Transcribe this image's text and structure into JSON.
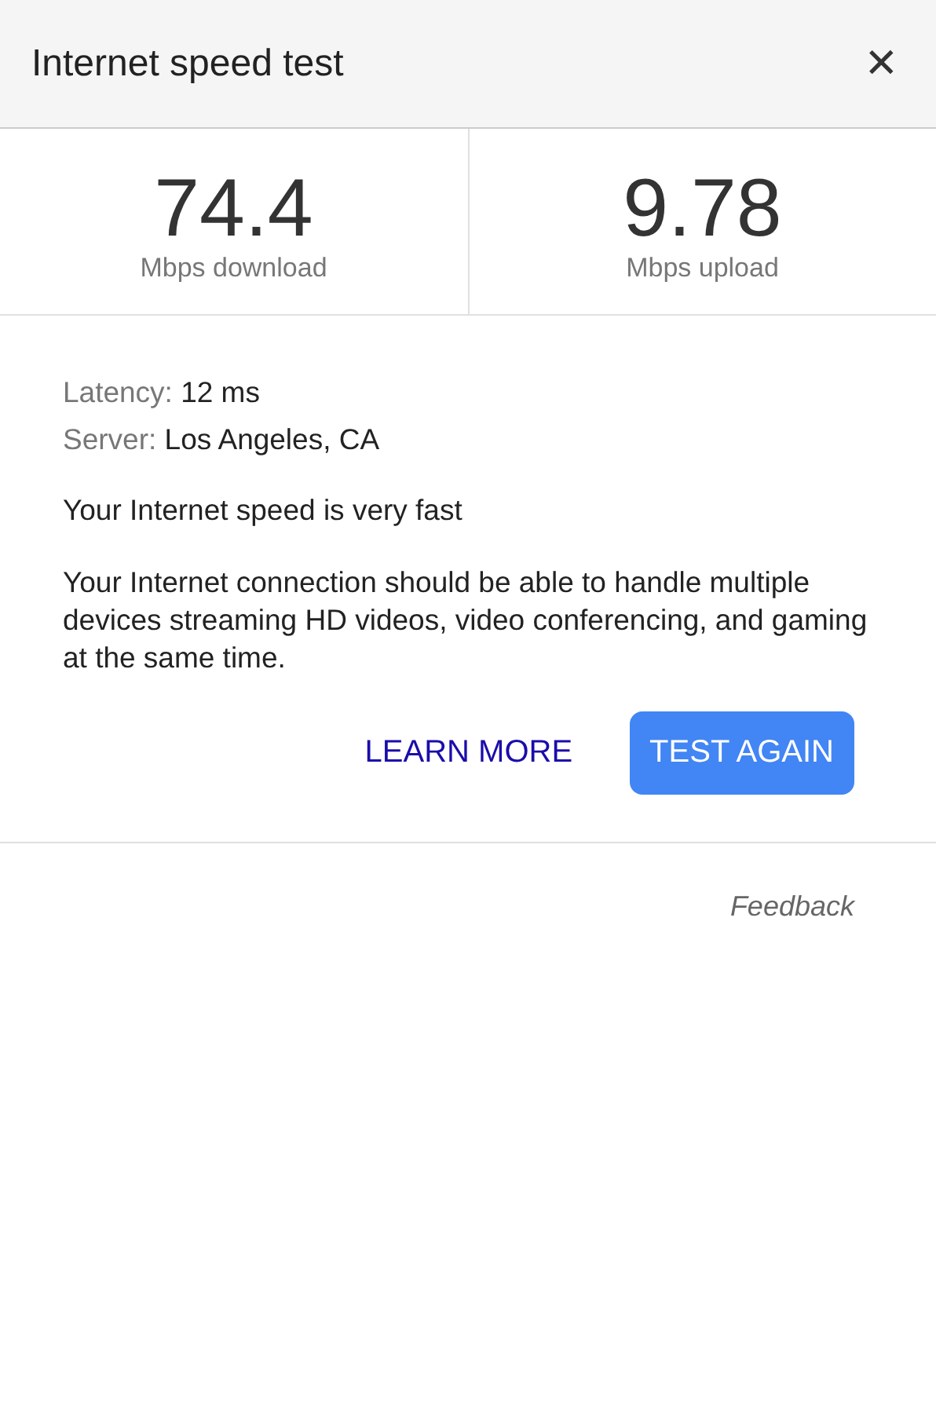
{
  "header": {
    "title": "Internet speed test",
    "close": "✕"
  },
  "stats": [
    {
      "value": "74.4",
      "label": "Mbps download"
    },
    {
      "value": "9.78",
      "label": "Mbps upload"
    }
  ],
  "details": [
    {
      "label": "Latency:",
      "value": "12 ms"
    },
    {
      "label": "Server:",
      "value": "Los Angeles, CA"
    }
  ],
  "verdict": "Your Internet speed is very fast",
  "description": "Your Internet connection should be able to handle multiple devices streaming HD videos, video conferencing, and gaming at the same time.",
  "actions": {
    "link": "LEARN MORE",
    "button": "TEST AGAIN"
  },
  "feedback": "Feedback"
}
